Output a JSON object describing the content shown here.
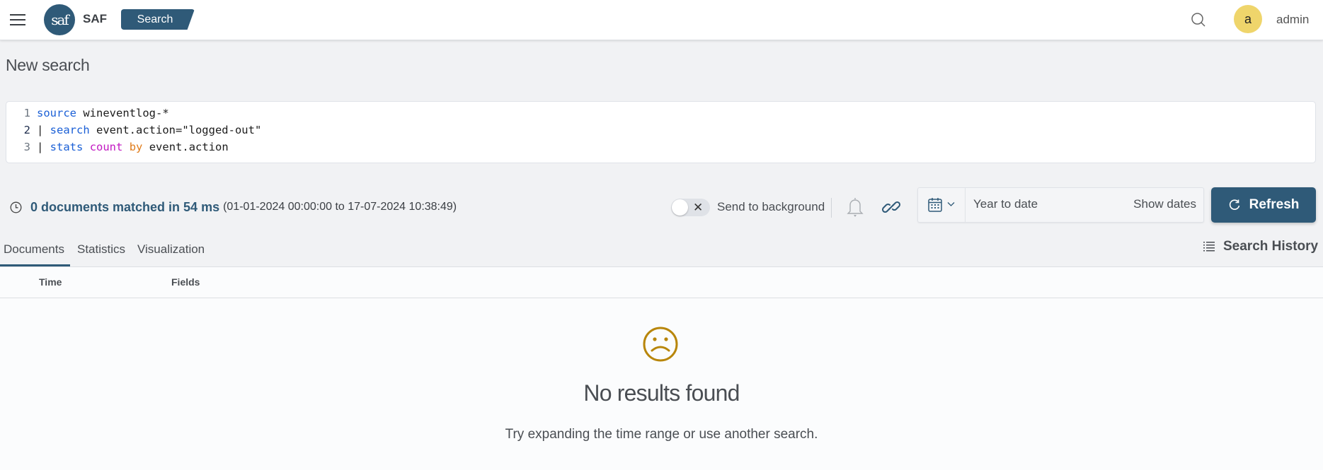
{
  "header": {
    "brand": "SAF",
    "logo_text": "saf",
    "app_badge": "Search",
    "user_initial": "a",
    "username": "admin",
    "icons": [
      "menu-icon",
      "search-icon"
    ]
  },
  "page": {
    "title": "New search"
  },
  "editor": {
    "lines": [
      {
        "number": "1",
        "tokens": [
          {
            "t": "source",
            "c": "kw"
          },
          {
            "t": " wineventlog-*",
            "c": ""
          }
        ]
      },
      {
        "number": "2",
        "tokens": [
          {
            "t": "| ",
            "c": "pipe"
          },
          {
            "t": "search",
            "c": "kw"
          },
          {
            "t": " event.action=\"logged-out\"",
            "c": ""
          }
        ]
      },
      {
        "number": "3",
        "tokens": [
          {
            "t": "| ",
            "c": "pipe"
          },
          {
            "t": "stats",
            "c": "kw"
          },
          {
            "t": " ",
            "c": ""
          },
          {
            "t": "count",
            "c": "fn"
          },
          {
            "t": " ",
            "c": ""
          },
          {
            "t": "by",
            "c": "by"
          },
          {
            "t": " event.action",
            "c": ""
          }
        ]
      }
    ],
    "active_line": 2
  },
  "status": {
    "summary": "0 documents matched in 54 ms",
    "range": "(01-01-2024 00:00:00 to 17-07-2024 10:38:49)"
  },
  "toolbar": {
    "background_toggle_label": "Send to background",
    "background_toggle_on": false,
    "date_range": "Year to date",
    "show_dates": "Show dates",
    "refresh": "Refresh"
  },
  "tabs": [
    {
      "label": "Documents",
      "active": true
    },
    {
      "label": "Statistics",
      "active": false
    },
    {
      "label": "Visualization",
      "active": false
    }
  ],
  "search_history": "Search History",
  "table": {
    "columns": [
      "Time",
      "Fields"
    ]
  },
  "empty_state": {
    "title": "No results found",
    "message": "Try expanding the time range or use another search."
  },
  "colors": {
    "primary": "#2f5a78",
    "avatar": "#efd56b",
    "empty_icon": "#b8860b"
  }
}
